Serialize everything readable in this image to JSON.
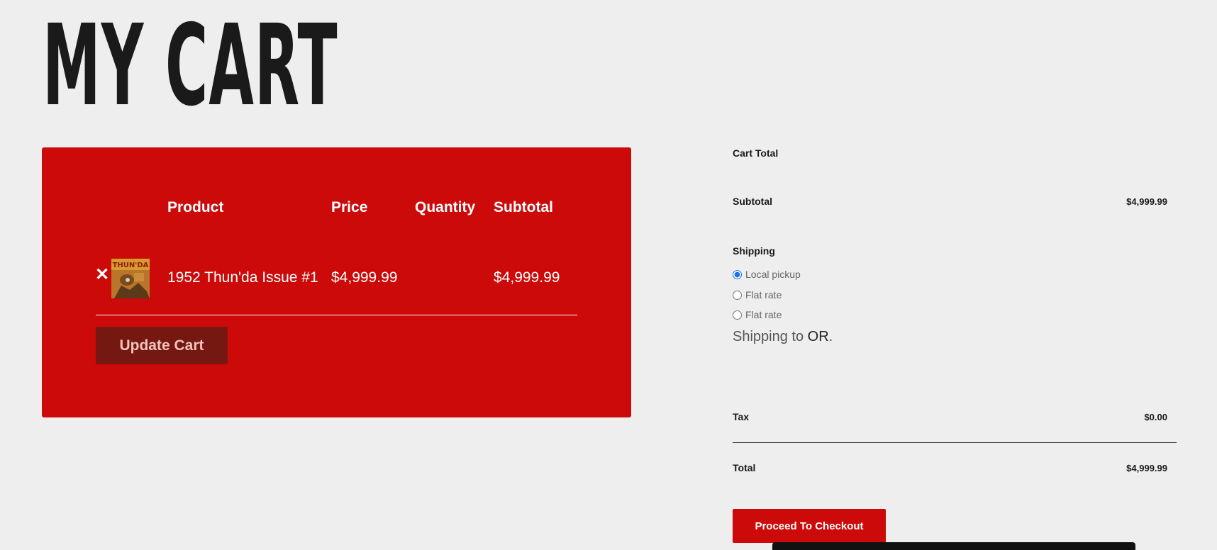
{
  "page": {
    "title": "MY CART"
  },
  "cart": {
    "columns": {
      "product": "Product",
      "price": "Price",
      "quantity": "Quantity",
      "subtotal": "Subtotal"
    },
    "items": [
      {
        "name": "1952 Thun'da Issue #1",
        "price": "$4,999.99",
        "quantity": "",
        "subtotal": "$4,999.99",
        "thumb_text": "THUN'DA",
        "remove_icon": "close-icon"
      }
    ],
    "update_label": "Update Cart"
  },
  "totals": {
    "heading": "Cart Total",
    "subtotal_label": "Subtotal",
    "subtotal_value": "$4,999.99",
    "shipping_label": "Shipping",
    "shipping_options": [
      {
        "label": "Local pickup",
        "selected": true
      },
      {
        "label": "Flat rate",
        "selected": false
      },
      {
        "label": "Flat rate",
        "selected": false
      }
    ],
    "shipping_to_prefix": "Shipping to ",
    "shipping_to_state": "OR",
    "shipping_to_suffix": ".",
    "tax_label": "Tax",
    "tax_value": "$0.00",
    "total_label": "Total",
    "total_value": "$4,999.99",
    "checkout_label": "Proceed To Checkout"
  },
  "colors": {
    "accent": "#cc0a0a",
    "update_button": "#751812",
    "background": "#eeeeee",
    "text": "#1a1a1a"
  }
}
